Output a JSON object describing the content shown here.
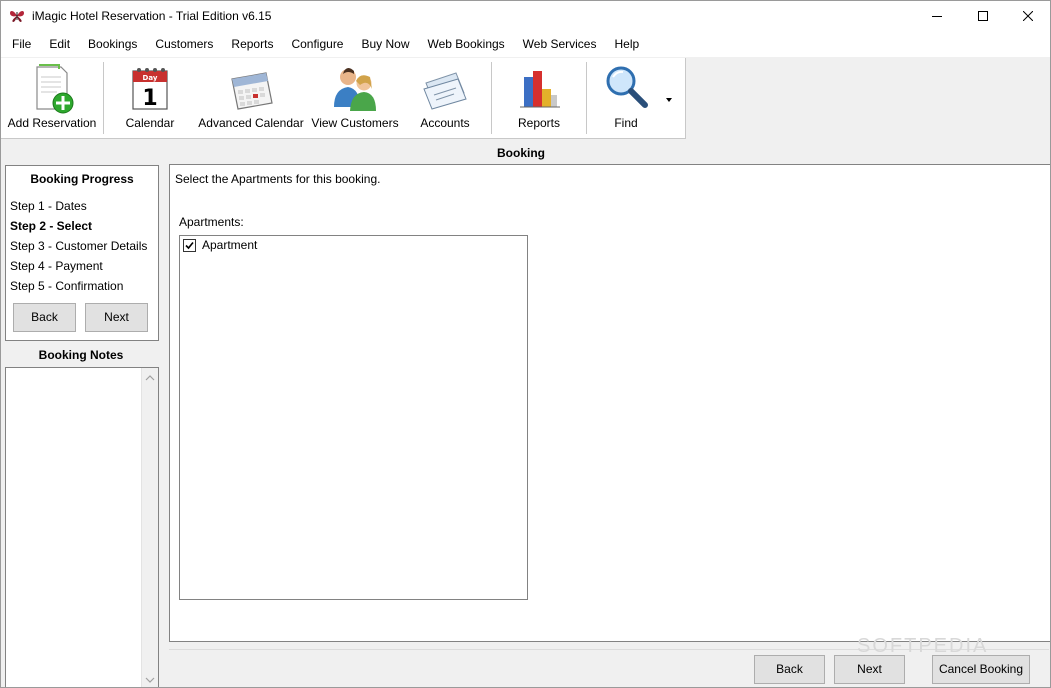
{
  "window": {
    "title": "iMagic Hotel Reservation - Trial Edition v6.15",
    "icon": "butterfly-icon"
  },
  "menu": [
    "File",
    "Edit",
    "Bookings",
    "Customers",
    "Reports",
    "Configure",
    "Buy Now",
    "Web Bookings",
    "Web Services",
    "Help"
  ],
  "toolbar": {
    "add_reservation": "Add Reservation",
    "calendar": "Calendar",
    "calendar_icon_text": "Day",
    "calendar_icon_number": "1",
    "advanced_calendar": "Advanced Calendar",
    "view_customers": "View Customers",
    "accounts": "Accounts",
    "reports": "Reports",
    "find": "Find"
  },
  "booking": {
    "title": "Booking",
    "instruction": "Select the Apartments for this booking.",
    "apartments_label": "Apartments:",
    "apartments": [
      {
        "label": "Apartment",
        "checked": true
      }
    ]
  },
  "progress": {
    "title": "Booking Progress",
    "steps": [
      "Step 1 - Dates",
      "Step 2 - Select",
      "Step 3 - Customer Details",
      "Step 4 - Payment",
      "Step 5 - Confirmation"
    ],
    "active_step": 1,
    "back": "Back",
    "next": "Next"
  },
  "notes": {
    "title": "Booking Notes"
  },
  "footer": {
    "back": "Back",
    "next": "Next",
    "cancel": "Cancel Booking"
  },
  "watermark": "SOFTPEDIA"
}
